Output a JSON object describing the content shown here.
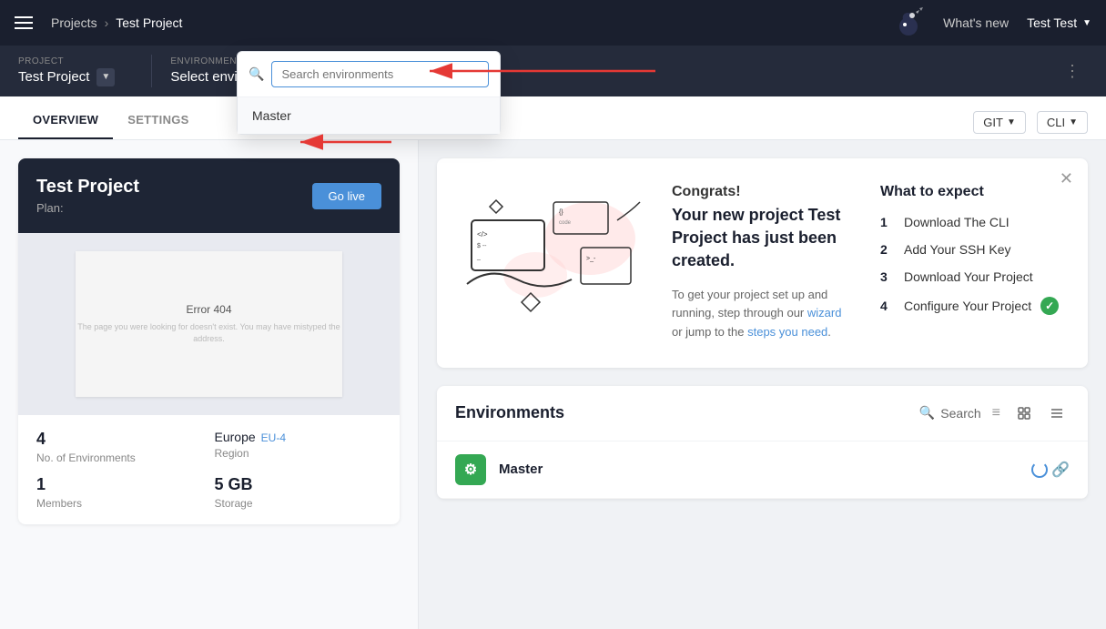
{
  "topnav": {
    "breadcrumb_projects": "Projects",
    "breadcrumb_separator": "›",
    "breadcrumb_current": "Test Project",
    "whats_new": "What's new",
    "user_name": "Test Test"
  },
  "subheader": {
    "project_label": "PROJECT",
    "project_name": "Test Project",
    "env_label": "ENVIRONMENT",
    "env_name": "Select environment"
  },
  "tabs": {
    "overview": "OVERVIEW",
    "settings": "SETTINGS",
    "git_label": "GIT",
    "cli_label": "CLI"
  },
  "project_card": {
    "title": "Test Project",
    "plan_label": "Plan:",
    "go_live": "Go live",
    "error_title": "Error 404",
    "error_text": "The page you were looking for doesn't exist. You may have mistyped the address.",
    "environments_count": "4",
    "environments_label": "No. of Environments",
    "members_count": "1",
    "members_label": "Members",
    "region_name": "Europe",
    "region_code": "EU-4",
    "region_label": "Region",
    "storage_value": "5 GB",
    "storage_label": "Storage"
  },
  "congrats": {
    "title": "Congrats!",
    "subtitle": "Your new project Test Project has just been created.",
    "body": "To get your project set up and running, step through our wizard or jump to the steps you need.",
    "wizard_link": "wizard",
    "steps_link": "steps you need"
  },
  "what_to_expect": {
    "title": "What to expect",
    "items": [
      {
        "num": "1",
        "label": "Download The CLI",
        "checked": false
      },
      {
        "num": "2",
        "label": "Add Your SSH Key",
        "checked": false
      },
      {
        "num": "3",
        "label": "Download Your Project",
        "checked": false
      },
      {
        "num": "4",
        "label": "Configure Your Project",
        "checked": true
      }
    ]
  },
  "environments_section": {
    "title": "Environments",
    "search_placeholder": "Search",
    "master_env": "Master"
  },
  "env_dropdown": {
    "search_placeholder": "Search environments",
    "master_option": "Master"
  }
}
